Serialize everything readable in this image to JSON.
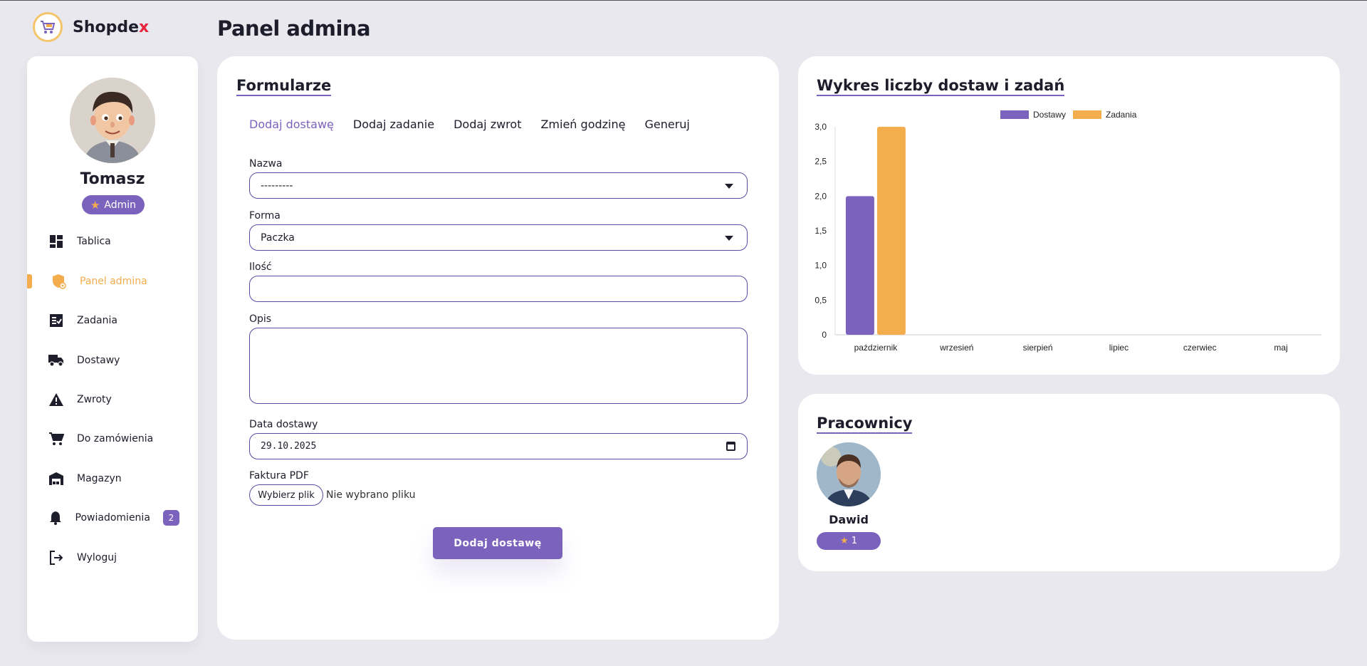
{
  "brand": {
    "name_prefix": "Shopde",
    "name_accent": "x",
    "accent_color": "#e8233a"
  },
  "page_title": "Panel admina",
  "user": {
    "name": "Tomasz",
    "role": "Admin"
  },
  "nav": {
    "items": [
      {
        "label": "Tablica",
        "icon": "dashboard-icon"
      },
      {
        "label": "Panel admina",
        "icon": "admin-shield-icon",
        "active": true
      },
      {
        "label": "Zadania",
        "icon": "tasks-icon"
      },
      {
        "label": "Dostawy",
        "icon": "truck-icon"
      },
      {
        "label": "Zwroty",
        "icon": "warning-icon"
      },
      {
        "label": "Do zamówienia",
        "icon": "cart-icon"
      },
      {
        "label": "Magazyn",
        "icon": "warehouse-icon"
      },
      {
        "label": "Powiadomienia",
        "icon": "bell-icon",
        "badge": "2"
      },
      {
        "label": "Wyloguj",
        "icon": "logout-icon"
      }
    ]
  },
  "forms": {
    "title": "Formularze",
    "tabs": [
      "Dodaj dostawę",
      "Dodaj zadanie",
      "Dodaj zwrot",
      "Zmień godzinę",
      "Generuj"
    ],
    "active_tab": "Dodaj dostawę",
    "fields": {
      "nazwa": {
        "label": "Nazwa",
        "value": "---------"
      },
      "forma": {
        "label": "Forma",
        "value": "Paczka"
      },
      "ilosc": {
        "label": "Ilość",
        "value": ""
      },
      "opis": {
        "label": "Opis",
        "value": ""
      },
      "data": {
        "label": "Data dostawy",
        "value": "29.10.2025"
      },
      "faktura": {
        "label": "Faktura PDF",
        "button": "Wybierz plik",
        "status": "Nie wybrano pliku"
      }
    },
    "submit": "Dodaj dostawę"
  },
  "chart": {
    "title": "Wykres liczby dostaw i zadań"
  },
  "chart_data": {
    "type": "bar",
    "categories": [
      "październik",
      "wrzesień",
      "sierpień",
      "lipiec",
      "czerwiec",
      "maj"
    ],
    "series": [
      {
        "name": "Dostawy",
        "values": [
          2,
          0,
          0,
          0,
          0,
          0
        ],
        "color": "#7b63bd"
      },
      {
        "name": "Zadania",
        "values": [
          3,
          0,
          0,
          0,
          0,
          0
        ],
        "color": "#f3ad4d"
      }
    ],
    "ylim": [
      0,
      3
    ],
    "yticks": [
      "0",
      "0,5",
      "1,0",
      "1,5",
      "2,0",
      "2,5",
      "3,0"
    ],
    "legend": "top-center",
    "grid": false
  },
  "workers": {
    "title": "Pracownicy",
    "list": [
      {
        "name": "Dawid",
        "rating": "1"
      }
    ]
  },
  "colors": {
    "primary": "#7b63bd",
    "accent": "#f3ad4d",
    "background": "#e8e8ee"
  }
}
